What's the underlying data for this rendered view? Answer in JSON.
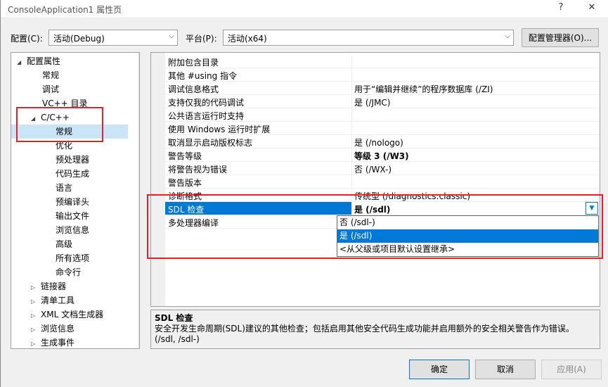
{
  "window": {
    "title": "ConsoleApplication1 属性页",
    "help": "?",
    "close": "✕"
  },
  "toolbar": {
    "config_label": "配置(C):",
    "config_value": "活动(Debug)",
    "platform_label": "平台(P):",
    "platform_value": "活动(x64)",
    "manager_button": "配置管理器(O)..."
  },
  "tree": {
    "items": [
      {
        "label": "配置属性",
        "expander": "◢"
      },
      {
        "label": "常规"
      },
      {
        "label": "调试"
      },
      {
        "label": "VC++ 目录"
      },
      {
        "label": "C/C++",
        "expander": "◢"
      },
      {
        "label": "常规"
      },
      {
        "label": "优化"
      },
      {
        "label": "预处理器"
      },
      {
        "label": "代码生成"
      },
      {
        "label": "语言"
      },
      {
        "label": "预编译头"
      },
      {
        "label": "输出文件"
      },
      {
        "label": "浏览信息"
      },
      {
        "label": "高级"
      },
      {
        "label": "所有选项"
      },
      {
        "label": "命令行"
      },
      {
        "label": "链接器",
        "expander": "▷"
      },
      {
        "label": "清单工具",
        "expander": "▷"
      },
      {
        "label": "XML 文档生成器",
        "expander": "▷"
      },
      {
        "label": "浏览信息",
        "expander": "▷"
      },
      {
        "label": "生成事件",
        "expander": "▷"
      }
    ]
  },
  "grid": {
    "rows": [
      {
        "name": "附加包含目录",
        "value": ""
      },
      {
        "name": "其他 #using 指令",
        "value": ""
      },
      {
        "name": "调试信息格式",
        "value": "用于“编辑并继续”的程序数据库 (/ZI)"
      },
      {
        "name": "支持仅我的代码调试",
        "value": "是 (/JMC)"
      },
      {
        "name": "公共语言运行时支持",
        "value": ""
      },
      {
        "name": "使用 Windows 运行时扩展",
        "value": ""
      },
      {
        "name": "取消显示启动版权标志",
        "value": "是 (/nologo)"
      },
      {
        "name": "警告等级",
        "value": "等级 3 (/W3)"
      },
      {
        "name": "将警告视为错误",
        "value": "否 (/WX-)"
      },
      {
        "name": "警告版本",
        "value": ""
      },
      {
        "name": "诊断格式",
        "value": "传统型 (/diagnostics:classic)"
      },
      {
        "name": "SDL 检查",
        "value": "是 (/sdl)"
      },
      {
        "name": "多处理器编译",
        "value": ""
      }
    ],
    "dropdown_options": [
      "否 (/sdl-)",
      "是 (/sdl)",
      "<从父级或项目默认设置继承>"
    ],
    "dropdown_arrow": "▼"
  },
  "description": {
    "title": "SDL 检查",
    "text": "安全开发生命周期(SDL)建议的其他检查；包括启用其他安全代码生成功能并启用额外的安全相关警告作为错误。",
    "flags": "(/sdl, /sdl-)"
  },
  "buttons": {
    "ok": "确定",
    "cancel": "取消",
    "apply": "应用(A)"
  },
  "colors": {
    "highlight": "#0078d7",
    "annotation": "#e8202a"
  }
}
